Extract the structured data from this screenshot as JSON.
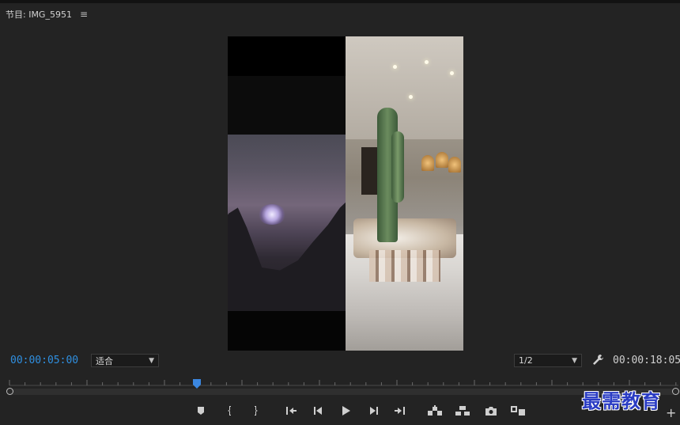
{
  "panel": {
    "title": "节目: IMG_5951",
    "menu_icon": "hamburger-menu-icon"
  },
  "monitor": {
    "left_clip": "sunset-silhouette",
    "right_clip": "shop-interior"
  },
  "bottom_bar": {
    "current_timecode": "00:00:05:00",
    "zoom_select": "适合",
    "resolution_select": "1/2",
    "duration_timecode": "00:00:18:05",
    "settings_icon": "wrench-icon"
  },
  "timeline": {
    "playhead_progress": 0.28
  },
  "controls": [
    {
      "name": "add-marker-button",
      "icon": "marker-icon"
    },
    {
      "name": "mark-in-button",
      "icon": "mark-in-icon"
    },
    {
      "name": "mark-out-button",
      "icon": "mark-out-icon"
    },
    {
      "name": "go-to-in-button",
      "icon": "go-to-in-icon"
    },
    {
      "name": "step-back-button",
      "icon": "step-back-icon"
    },
    {
      "name": "play-button",
      "icon": "play-icon"
    },
    {
      "name": "step-forward-button",
      "icon": "step-forward-icon"
    },
    {
      "name": "go-to-out-button",
      "icon": "go-to-out-icon"
    },
    {
      "name": "lift-button",
      "icon": "lift-icon"
    },
    {
      "name": "extract-button",
      "icon": "extract-icon"
    },
    {
      "name": "export-frame-button",
      "icon": "camera-icon"
    },
    {
      "name": "comparison-view-button",
      "icon": "comparison-icon"
    }
  ],
  "watermark": "最需教育",
  "colors": {
    "accent_timecode": "#2f8fe0",
    "playhead": "#3b87e0",
    "background": "#232323"
  }
}
